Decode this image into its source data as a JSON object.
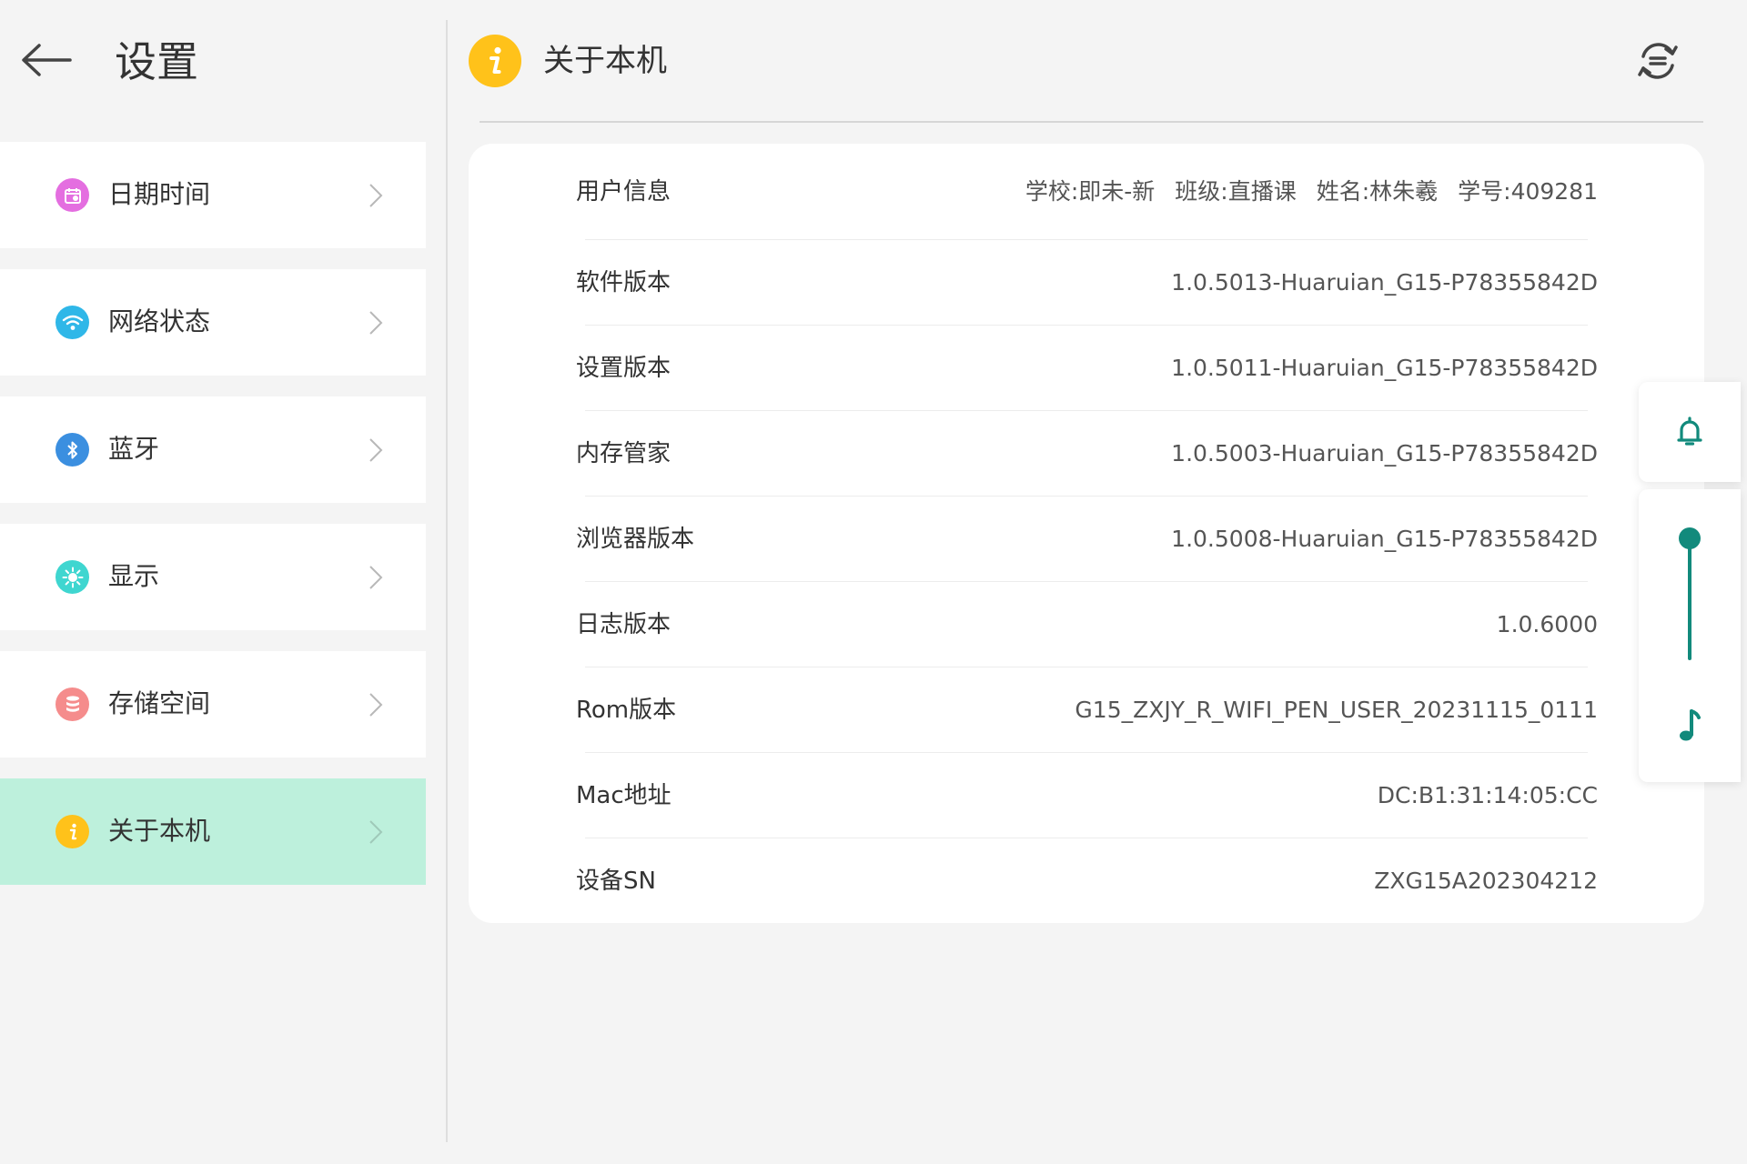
{
  "header": {
    "back_icon": "back-arrow-icon",
    "title": "设置"
  },
  "sidebar": {
    "items": [
      {
        "label": "日期时间",
        "icon": "calendar-icon",
        "icon_color": "#e46ee0",
        "active": false
      },
      {
        "label": "网络状态",
        "icon": "wifi-icon",
        "icon_color": "#2fb7e8",
        "active": false
      },
      {
        "label": "蓝牙",
        "icon": "bluetooth-icon",
        "icon_color": "#3b8fe0",
        "active": false
      },
      {
        "label": "显示",
        "icon": "brightness-icon",
        "icon_color": "#3fd6d0",
        "active": false
      },
      {
        "label": "存储空间",
        "icon": "storage-icon",
        "icon_color": "#f58c8c",
        "active": false
      },
      {
        "label": "关于本机",
        "icon": "info-icon",
        "icon_color": "#ffc21a",
        "active": true
      }
    ],
    "active_background": "#bdf0dc"
  },
  "detail": {
    "title": "关于本机",
    "title_icon": "info-icon",
    "refresh_icon": "refresh-icon",
    "user_info": {
      "label": "用户信息",
      "values": [
        "学校:即未-新",
        "班级:直播课",
        "姓名:林朱羲",
        "学号:409281"
      ]
    },
    "rows": [
      {
        "label": "软件版本",
        "value": "1.0.5013-Huaruian_G15-P78355842D"
      },
      {
        "label": "设置版本",
        "value": "1.0.5011-Huaruian_G15-P78355842D"
      },
      {
        "label": "内存管家",
        "value": "1.0.5003-Huaruian_G15-P78355842D"
      },
      {
        "label": "浏览器版本",
        "value": "1.0.5008-Huaruian_G15-P78355842D"
      },
      {
        "label": "日志版本",
        "value": "1.0.6000"
      },
      {
        "label": "Rom版本",
        "value": "G15_ZXJY_R_WIFI_PEN_USER_20231115_0111"
      },
      {
        "label": "Mac地址",
        "value": "DC:B1:31:14:05:CC"
      },
      {
        "label": "设备SN",
        "value": "ZXG15A202304212"
      }
    ]
  },
  "floating": {
    "bell_icon": "bell-icon",
    "volume_slider_level": 1.0,
    "music_icon": "music-note-icon",
    "accent_color": "#128a7c"
  }
}
